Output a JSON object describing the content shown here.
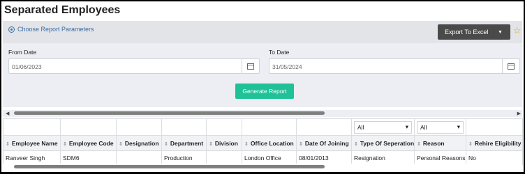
{
  "page": {
    "title": "Separated Employees"
  },
  "toolbar": {
    "params_label": "Choose Report Parameters",
    "export_label": "Export To Excel"
  },
  "filters": {
    "from_label": "From Date",
    "from_value": "01/06/2023",
    "to_label": "To Date",
    "to_value": "31/05/2024",
    "generate_label": "Generate Report"
  },
  "icons": {
    "star": "star-icon",
    "calendar": "calendar-icon",
    "params": "radio-icon"
  },
  "colors": {
    "accent": "#1fc197",
    "export_bg": "#4a4a4a",
    "star": "#e2a400"
  },
  "table": {
    "filter_selects": [
      "All",
      "All"
    ],
    "columns": [
      "Employee Name",
      "Employee Code",
      "Designation",
      "Department",
      "Division",
      "Office Location",
      "Date Of Joining",
      "Type Of Seperation",
      "Reason",
      "Rehire Eligibility"
    ],
    "rows": [
      [
        "Ranveer Singh",
        "SDM6",
        "",
        "Production",
        "",
        "London Office",
        "08/01/2013",
        "Resignation",
        "Personal Reasons",
        "No"
      ]
    ]
  }
}
